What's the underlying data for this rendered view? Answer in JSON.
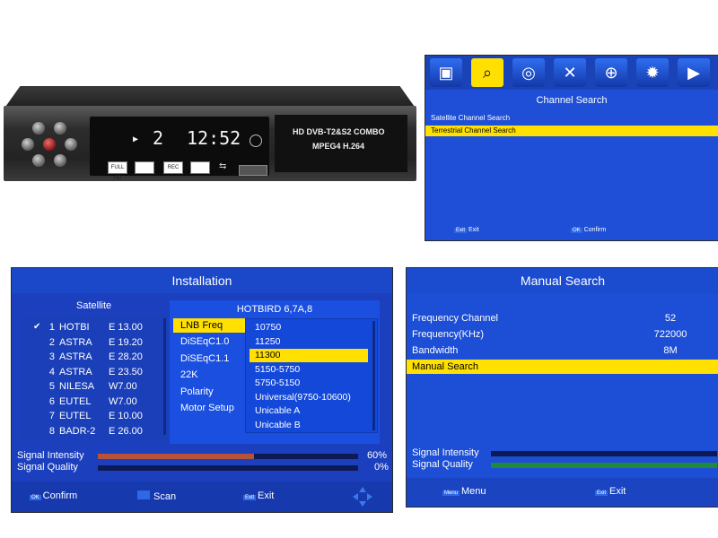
{
  "stb": {
    "display_play": "▶",
    "display_channel": "2",
    "display_time": "12:52",
    "label_line1": "HD DVB-T2&S2 COMBO",
    "label_line2": "MPEG4 H.264",
    "badges": [
      "FULL HD",
      "",
      "REC",
      "",
      ""
    ],
    "usb_icon": "usb-icon"
  },
  "channel_search": {
    "icons": [
      "tv-icon",
      "search-icon",
      "disc-icon",
      "tools-icon",
      "globe-icon",
      "gear-icon",
      "play-icon"
    ],
    "active_icon_index": 1,
    "title": "Channel Search",
    "items": [
      "Satellite Channel Search",
      "Terrestrial Channel Search"
    ],
    "selected_index": 1,
    "footer": {
      "exit_key": "Exit",
      "exit_label": "Exit",
      "ok_key": "OK",
      "ok_label": "Confirm"
    }
  },
  "installation": {
    "title": "Installation",
    "satellite_header": "Satellite",
    "satellites": [
      {
        "num": "1",
        "name": "HOTBI",
        "pos": "E 13.00",
        "checked": true
      },
      {
        "num": "2",
        "name": "ASTRA",
        "pos": "E 19.20",
        "checked": false
      },
      {
        "num": "3",
        "name": "ASTRA",
        "pos": "E 28.20",
        "checked": false
      },
      {
        "num": "4",
        "name": "ASTRA",
        "pos": "E 23.50",
        "checked": false
      },
      {
        "num": "5",
        "name": "NILESA",
        "pos": "W7.00",
        "checked": false
      },
      {
        "num": "6",
        "name": "EUTEL",
        "pos": "W7.00",
        "checked": false
      },
      {
        "num": "7",
        "name": "EUTEL",
        "pos": "E 10.00",
        "checked": false
      },
      {
        "num": "8",
        "name": "BADR-2",
        "pos": "E 26.00",
        "checked": false
      }
    ],
    "sat_name": "HOTBIRD 6,7A,8",
    "settings": [
      "LNB Freq",
      "DiSEqC1.0",
      "DiSEqC1.1",
      "22K",
      "Polarity",
      "Motor Setup"
    ],
    "selected_setting_index": 0,
    "lnb_options": [
      "10750",
      "11250",
      "11300",
      "5150-5750",
      "5750-5150",
      "Universal(9750-10600)",
      "Unicable A",
      "Unicable B"
    ],
    "selected_lnb_index": 2,
    "signal_intensity_label": "Signal Intensity",
    "signal_intensity_value": "60%",
    "signal_intensity_fraction": 0.6,
    "signal_quality_label": "Signal Quality",
    "signal_quality_value": "0%",
    "signal_quality_fraction": 0.0,
    "footer": {
      "ok_key": "OK",
      "ok_label": "Confirm",
      "scan_label": "Scan",
      "exit_key": "Exit",
      "exit_label": "Exit"
    },
    "colors": {
      "intensity": "#b5523a",
      "quality": "#2c2c8a"
    }
  },
  "manual_search": {
    "title": "Manual Search",
    "rows": [
      {
        "label": "Frequency Channel",
        "value": "52"
      },
      {
        "label": "Frequency(KHz)",
        "value": "722000"
      },
      {
        "label": "Bandwidth",
        "value": "8M"
      },
      {
        "label": "Manual Search",
        "value": ""
      }
    ],
    "selected_index": 3,
    "signal_intensity_label": "Signal Intensity",
    "signal_quality_label": "Signal Quality",
    "signal_quality_fraction": 1.0,
    "footer": {
      "menu_key": "Menu",
      "menu_label": "Menu",
      "exit_key": "Exit",
      "exit_label": "Exit"
    },
    "colors": {
      "quality": "#1f8a3a"
    }
  }
}
